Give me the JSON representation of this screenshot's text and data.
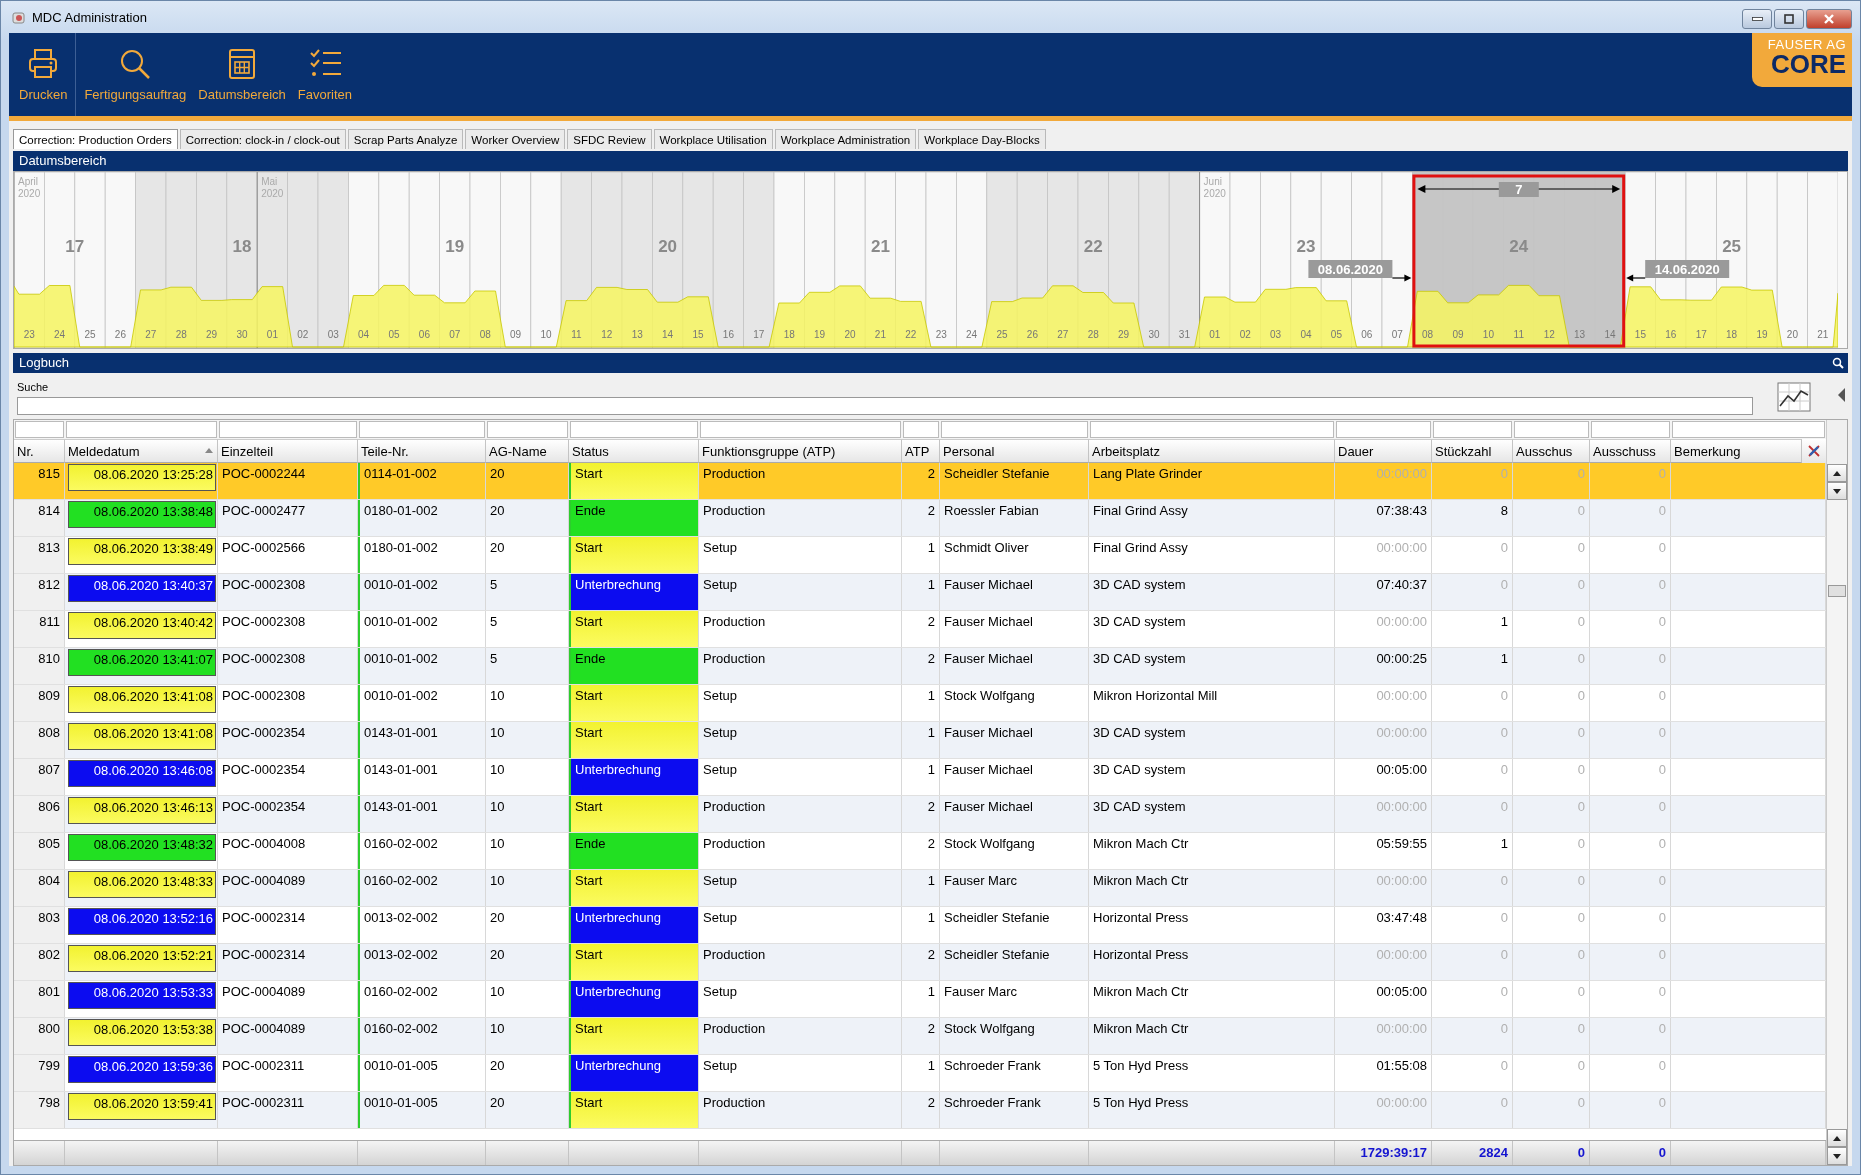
{
  "window": {
    "title": "MDC Administration"
  },
  "toolbar": [
    {
      "label": "Drucken"
    },
    {
      "label": "Fertigungsauftrag"
    },
    {
      "label": "Datumsbereich"
    },
    {
      "label": "Favoriten"
    }
  ],
  "logo": {
    "line1": "FAUSER AG",
    "line2": "CORE"
  },
  "tabs": [
    {
      "label": "Correction: Production Orders",
      "selected": true
    },
    {
      "label": "Correction: clock-in / clock-out",
      "selected": false
    },
    {
      "label": "Scrap Parts Analyze",
      "selected": false
    },
    {
      "label": "Worker Overview",
      "selected": false
    },
    {
      "label": "SFDC Review",
      "selected": false
    },
    {
      "label": "Workplace Utilisation",
      "selected": false
    },
    {
      "label": "Workplace Administration",
      "selected": false
    },
    {
      "label": "Workplace Day-Blocks",
      "selected": false
    }
  ],
  "timeline": {
    "title": "Datumsbereich",
    "range_start": "08.06.2020",
    "range_end": "14.06.2020",
    "range_length": "7",
    "weeks": [
      {
        "label": "17",
        "days": [
          {
            "label": "23",
            "month": "April",
            "year": "2020",
            "selected": false
          },
          {
            "label": "24",
            "selected": false
          },
          {
            "label": "25",
            "selected": false
          },
          {
            "label": "26",
            "selected": false
          }
        ]
      },
      {
        "label": "18",
        "days": [
          {
            "label": "27",
            "selected": false
          },
          {
            "label": "28",
            "selected": false
          },
          {
            "label": "29",
            "selected": false
          },
          {
            "label": "30",
            "selected": false
          },
          {
            "label": "01",
            "month": "Mai",
            "year": "2020",
            "selected": false
          },
          {
            "label": "02",
            "selected": false
          },
          {
            "label": "03",
            "selected": false
          }
        ]
      },
      {
        "label": "19",
        "days": [
          {
            "label": "04",
            "selected": false
          },
          {
            "label": "05",
            "selected": false
          },
          {
            "label": "06",
            "selected": false
          },
          {
            "label": "07",
            "selected": false
          },
          {
            "label": "08",
            "selected": false
          },
          {
            "label": "09",
            "selected": false
          },
          {
            "label": "10",
            "selected": false
          }
        ]
      },
      {
        "label": "20",
        "days": [
          {
            "label": "11",
            "selected": false
          },
          {
            "label": "12",
            "selected": false
          },
          {
            "label": "13",
            "selected": false
          },
          {
            "label": "14",
            "selected": false
          },
          {
            "label": "15",
            "selected": false
          },
          {
            "label": "16",
            "selected": false
          },
          {
            "label": "17",
            "selected": false
          }
        ]
      },
      {
        "label": "21",
        "days": [
          {
            "label": "18",
            "selected": false
          },
          {
            "label": "19",
            "selected": false
          },
          {
            "label": "20",
            "selected": false
          },
          {
            "label": "21",
            "selected": false
          },
          {
            "label": "22",
            "selected": false
          },
          {
            "label": "23",
            "selected": false
          },
          {
            "label": "24",
            "selected": false
          }
        ]
      },
      {
        "label": "22",
        "days": [
          {
            "label": "25",
            "selected": false
          },
          {
            "label": "26",
            "selected": false
          },
          {
            "label": "27",
            "selected": false
          },
          {
            "label": "28",
            "selected": false
          },
          {
            "label": "29",
            "selected": false
          },
          {
            "label": "30",
            "selected": false
          },
          {
            "label": "31",
            "selected": false
          }
        ]
      },
      {
        "label": "23",
        "days": [
          {
            "label": "01",
            "month": "Juni",
            "year": "2020",
            "selected": false
          },
          {
            "label": "02",
            "selected": false
          },
          {
            "label": "03",
            "selected": false
          },
          {
            "label": "04",
            "selected": false
          },
          {
            "label": "05",
            "selected": false
          },
          {
            "label": "06",
            "selected": false
          },
          {
            "label": "07",
            "selected": false
          }
        ]
      },
      {
        "label": "24",
        "days": [
          {
            "label": "08",
            "selected": true
          },
          {
            "label": "09",
            "selected": true
          },
          {
            "label": "10",
            "selected": true
          },
          {
            "label": "11",
            "selected": true
          },
          {
            "label": "12",
            "selected": true
          },
          {
            "label": "13",
            "selected": true
          },
          {
            "label": "14",
            "selected": true
          }
        ]
      },
      {
        "label": "25",
        "days": [
          {
            "label": "15",
            "selected": false
          },
          {
            "label": "16",
            "selected": false
          },
          {
            "label": "17",
            "selected": false
          },
          {
            "label": "18",
            "selected": false
          },
          {
            "label": "19",
            "selected": false
          },
          {
            "label": "20",
            "selected": false
          },
          {
            "label": "21",
            "selected": false
          }
        ]
      }
    ]
  },
  "logbook": {
    "title": "Logbuch",
    "search_label": "Suche"
  },
  "table": {
    "columns": [
      {
        "label": "Nr."
      },
      {
        "label": "Meldedatum",
        "sorted": true
      },
      {
        "label": "Einzelteil"
      },
      {
        "label": "Teile-Nr."
      },
      {
        "label": "AG-Name"
      },
      {
        "label": "Status"
      },
      {
        "label": "Funktionsgruppe (ATP)"
      },
      {
        "label": "ATP"
      },
      {
        "label": "Personal"
      },
      {
        "label": "Arbeitsplatz"
      },
      {
        "label": "Dauer"
      },
      {
        "label": "Stückzahl"
      },
      {
        "label": "Ausschus"
      },
      {
        "label": "Ausschuss"
      },
      {
        "label": "Bemerkung"
      }
    ],
    "rows": [
      {
        "selected": true,
        "kind": "start",
        "cells": [
          "815",
          "08.06.2020 13:25:28",
          "POC-0002244",
          "0114-01-002",
          "20",
          "Start",
          "Production",
          "2",
          "Scheidler Stefanie",
          "Lang Plate Grinder"
        ],
        "values": [
          {
            "text": "00:00:00",
            "dimmed": true
          },
          {
            "text": "0",
            "dimmed": true
          },
          {
            "text": "0",
            "dimmed": true
          },
          {
            "text": "0",
            "dimmed": true
          }
        ]
      },
      {
        "selected": false,
        "kind": "end",
        "cells": [
          "814",
          "08.06.2020 13:38:48",
          "POC-0002477",
          "0180-01-002",
          "20",
          "Ende",
          "Production",
          "2",
          "Roessler Fabian",
          "Final Grind Assy"
        ],
        "values": [
          {
            "text": "07:38:43",
            "dimmed": false
          },
          {
            "text": "8",
            "dimmed": false
          },
          {
            "text": "0",
            "dimmed": true
          },
          {
            "text": "0",
            "dimmed": true
          }
        ]
      },
      {
        "selected": false,
        "kind": "start",
        "cells": [
          "813",
          "08.06.2020 13:38:49",
          "POC-0002566",
          "0180-01-002",
          "20",
          "Start",
          "Setup",
          "1",
          "Schmidt Oliver",
          "Final Grind Assy"
        ],
        "values": [
          {
            "text": "00:00:00",
            "dimmed": true
          },
          {
            "text": "0",
            "dimmed": true
          },
          {
            "text": "0",
            "dimmed": true
          },
          {
            "text": "0",
            "dimmed": true
          }
        ]
      },
      {
        "selected": false,
        "kind": "break",
        "cells": [
          "812",
          "08.06.2020 13:40:37",
          "POC-0002308",
          "0010-01-002",
          "5",
          "Unterbrechung",
          "Setup",
          "1",
          "Fauser Michael",
          "3D CAD system"
        ],
        "values": [
          {
            "text": "07:40:37",
            "dimmed": false
          },
          {
            "text": "0",
            "dimmed": true
          },
          {
            "text": "0",
            "dimmed": true
          },
          {
            "text": "0",
            "dimmed": true
          }
        ]
      },
      {
        "selected": false,
        "kind": "start",
        "cells": [
          "811",
          "08.06.2020 13:40:42",
          "POC-0002308",
          "0010-01-002",
          "5",
          "Start",
          "Production",
          "2",
          "Fauser Michael",
          "3D CAD system"
        ],
        "values": [
          {
            "text": "00:00:00",
            "dimmed": true
          },
          {
            "text": "1",
            "dimmed": false
          },
          {
            "text": "0",
            "dimmed": true
          },
          {
            "text": "0",
            "dimmed": true
          }
        ]
      },
      {
        "selected": false,
        "kind": "end",
        "cells": [
          "810",
          "08.06.2020 13:41:07",
          "POC-0002308",
          "0010-01-002",
          "5",
          "Ende",
          "Production",
          "2",
          "Fauser Michael",
          "3D CAD system"
        ],
        "values": [
          {
            "text": "00:00:25",
            "dimmed": false
          },
          {
            "text": "1",
            "dimmed": false
          },
          {
            "text": "0",
            "dimmed": true
          },
          {
            "text": "0",
            "dimmed": true
          }
        ]
      },
      {
        "selected": false,
        "kind": "start",
        "cells": [
          "809",
          "08.06.2020 13:41:08",
          "POC-0002308",
          "0010-01-002",
          "10",
          "Start",
          "Setup",
          "1",
          "Stock Wolfgang",
          "Mikron Horizontal Mill"
        ],
        "values": [
          {
            "text": "00:00:00",
            "dimmed": true
          },
          {
            "text": "0",
            "dimmed": true
          },
          {
            "text": "0",
            "dimmed": true
          },
          {
            "text": "0",
            "dimmed": true
          }
        ]
      },
      {
        "selected": false,
        "kind": "start",
        "cells": [
          "808",
          "08.06.2020 13:41:08",
          "POC-0002354",
          "0143-01-001",
          "10",
          "Start",
          "Setup",
          "1",
          "Fauser Michael",
          "3D CAD system"
        ],
        "values": [
          {
            "text": "00:00:00",
            "dimmed": true
          },
          {
            "text": "0",
            "dimmed": true
          },
          {
            "text": "0",
            "dimmed": true
          },
          {
            "text": "0",
            "dimmed": true
          }
        ]
      },
      {
        "selected": false,
        "kind": "break",
        "cells": [
          "807",
          "08.06.2020 13:46:08",
          "POC-0002354",
          "0143-01-001",
          "10",
          "Unterbrechung",
          "Setup",
          "1",
          "Fauser Michael",
          "3D CAD system"
        ],
        "values": [
          {
            "text": "00:05:00",
            "dimmed": false
          },
          {
            "text": "0",
            "dimmed": true
          },
          {
            "text": "0",
            "dimmed": true
          },
          {
            "text": "0",
            "dimmed": true
          }
        ]
      },
      {
        "selected": false,
        "kind": "start",
        "cells": [
          "806",
          "08.06.2020 13:46:13",
          "POC-0002354",
          "0143-01-001",
          "10",
          "Start",
          "Production",
          "2",
          "Fauser Michael",
          "3D CAD system"
        ],
        "values": [
          {
            "text": "00:00:00",
            "dimmed": true
          },
          {
            "text": "0",
            "dimmed": true
          },
          {
            "text": "0",
            "dimmed": true
          },
          {
            "text": "0",
            "dimmed": true
          }
        ]
      },
      {
        "selected": false,
        "kind": "end",
        "cells": [
          "805",
          "08.06.2020 13:48:32",
          "POC-0004008",
          "0160-02-002",
          "10",
          "Ende",
          "Production",
          "2",
          "Stock Wolfgang",
          "Mikron Mach Ctr"
        ],
        "values": [
          {
            "text": "05:59:55",
            "dimmed": false
          },
          {
            "text": "1",
            "dimmed": false
          },
          {
            "text": "0",
            "dimmed": true
          },
          {
            "text": "0",
            "dimmed": true
          }
        ]
      },
      {
        "selected": false,
        "kind": "start",
        "cells": [
          "804",
          "08.06.2020 13:48:33",
          "POC-0004089",
          "0160-02-002",
          "10",
          "Start",
          "Setup",
          "1",
          "Fauser Marc",
          "Mikron Mach Ctr"
        ],
        "values": [
          {
            "text": "00:00:00",
            "dimmed": true
          },
          {
            "text": "0",
            "dimmed": true
          },
          {
            "text": "0",
            "dimmed": true
          },
          {
            "text": "0",
            "dimmed": true
          }
        ]
      },
      {
        "selected": false,
        "kind": "break",
        "cells": [
          "803",
          "08.06.2020 13:52:16",
          "POC-0002314",
          "0013-02-002",
          "20",
          "Unterbrechung",
          "Setup",
          "1",
          "Scheidler Stefanie",
          "Horizontal Press"
        ],
        "values": [
          {
            "text": "03:47:48",
            "dimmed": false
          },
          {
            "text": "0",
            "dimmed": true
          },
          {
            "text": "0",
            "dimmed": true
          },
          {
            "text": "0",
            "dimmed": true
          }
        ]
      },
      {
        "selected": false,
        "kind": "start",
        "cells": [
          "802",
          "08.06.2020 13:52:21",
          "POC-0002314",
          "0013-02-002",
          "20",
          "Start",
          "Production",
          "2",
          "Scheidler Stefanie",
          "Horizontal Press"
        ],
        "values": [
          {
            "text": "00:00:00",
            "dimmed": true
          },
          {
            "text": "0",
            "dimmed": true
          },
          {
            "text": "0",
            "dimmed": true
          },
          {
            "text": "0",
            "dimmed": true
          }
        ]
      },
      {
        "selected": false,
        "kind": "break",
        "cells": [
          "801",
          "08.06.2020 13:53:33",
          "POC-0004089",
          "0160-02-002",
          "10",
          "Unterbrechung",
          "Setup",
          "1",
          "Fauser Marc",
          "Mikron Mach Ctr"
        ],
        "values": [
          {
            "text": "00:05:00",
            "dimmed": false
          },
          {
            "text": "0",
            "dimmed": true
          },
          {
            "text": "0",
            "dimmed": true
          },
          {
            "text": "0",
            "dimmed": true
          }
        ]
      },
      {
        "selected": false,
        "kind": "start",
        "cells": [
          "800",
          "08.06.2020 13:53:38",
          "POC-0004089",
          "0160-02-002",
          "10",
          "Start",
          "Production",
          "2",
          "Stock Wolfgang",
          "Mikron Mach Ctr"
        ],
        "values": [
          {
            "text": "00:00:00",
            "dimmed": true
          },
          {
            "text": "0",
            "dimmed": true
          },
          {
            "text": "0",
            "dimmed": true
          },
          {
            "text": "0",
            "dimmed": true
          }
        ]
      },
      {
        "selected": false,
        "kind": "break",
        "cells": [
          "799",
          "08.06.2020 13:59:36",
          "POC-0002311",
          "0010-01-005",
          "20",
          "Unterbrechung",
          "Setup",
          "1",
          "Schroeder Frank",
          "5 Ton Hyd Press"
        ],
        "values": [
          {
            "text": "01:55:08",
            "dimmed": false
          },
          {
            "text": "0",
            "dimmed": true
          },
          {
            "text": "0",
            "dimmed": true
          },
          {
            "text": "0",
            "dimmed": true
          }
        ]
      },
      {
        "selected": false,
        "kind": "start",
        "cells": [
          "798",
          "08.06.2020 13:59:41",
          "POC-0002311",
          "0010-01-005",
          "20",
          "Start",
          "Production",
          "2",
          "Schroeder Frank",
          "5 Ton Hyd Press"
        ],
        "values": [
          {
            "text": "00:00:00",
            "dimmed": true
          },
          {
            "text": "0",
            "dimmed": true
          },
          {
            "text": "0",
            "dimmed": true
          },
          {
            "text": "0",
            "dimmed": true
          }
        ]
      }
    ],
    "totals": [
      "1729:39:17",
      "2824",
      "0",
      "0"
    ]
  }
}
